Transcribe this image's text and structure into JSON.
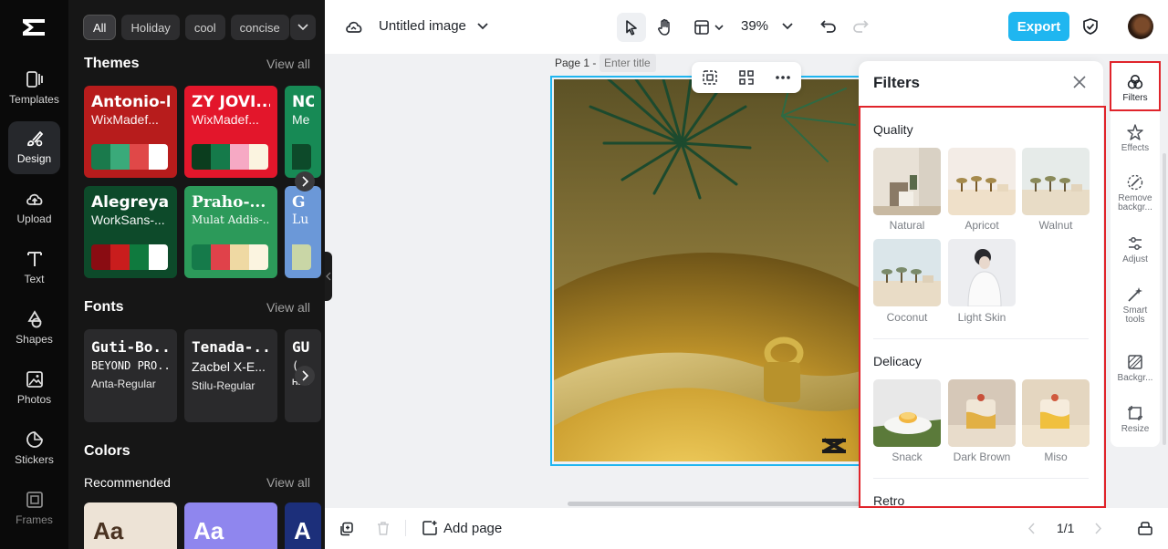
{
  "app": {
    "nav": [
      {
        "label": "Templates",
        "icon": "templates-icon"
      },
      {
        "label": "Design",
        "icon": "design-icon",
        "active": true
      },
      {
        "label": "Upload",
        "icon": "upload-cloud-icon"
      },
      {
        "label": "Text",
        "icon": "text-icon"
      },
      {
        "label": "Shapes",
        "icon": "shapes-icon"
      },
      {
        "label": "Photos",
        "icon": "photos-icon"
      },
      {
        "label": "Stickers",
        "icon": "stickers-icon"
      },
      {
        "label": "Frames",
        "icon": "frames-icon"
      }
    ]
  },
  "panel": {
    "chips": [
      "All",
      "Holiday",
      "cool",
      "concise"
    ],
    "themes": {
      "title": "Themes",
      "view_all": "View all",
      "cards": [
        {
          "font": "Antonio-Bold",
          "sub": "WixMadef...",
          "bg": "#b71c1c",
          "colors": [
            "#1a7a4c",
            "#3aaa7a",
            "#e04848",
            "#ffffff"
          ]
        },
        {
          "font": "ZY JOVI...",
          "sub": "WixMadef...",
          "bg": "#e3162b",
          "colors": [
            "#0b3d1e",
            "#157a4a",
            "#f6a9c4",
            "#fbf4e0"
          ]
        },
        {
          "font": "NO",
          "sub": "Me",
          "bg": "#178a55",
          "colors": [
            "#0d4a2a"
          ]
        },
        {
          "font": "AlegreyaS...",
          "sub": "WorkSans-...",
          "bg": "#0d4a2a",
          "colors": [
            "#8a0c12",
            "#c91d1d",
            "#0f7a3e",
            "#ffffff"
          ]
        },
        {
          "font": "Praho-...",
          "sub": "Mulat Addis-...",
          "bg": "#2c9a5a",
          "colors": [
            "#157a4a",
            "#e0424a",
            "#efd9a3",
            "#fbf4e0"
          ]
        },
        {
          "font": "G",
          "sub": "Lu",
          "bg": "#6b98d8",
          "colors": [
            "#c9d6a6"
          ]
        }
      ]
    },
    "fonts": {
      "title": "Fonts",
      "view_all": "View all",
      "cards": [
        {
          "f1": "Guti-Bo...",
          "f2": "BEYOND PRO...",
          "f3": "Anta-Regular"
        },
        {
          "f1": "Tenada-...",
          "f2": "Zacbel X-E...",
          "f3": "Stilu-Regular"
        },
        {
          "f1": "GU",
          "f2": "(",
          "f3": "Ham"
        }
      ]
    },
    "colors": {
      "title": "Colors",
      "subtitle": "Recommended",
      "view_all": "View all",
      "cards": [
        {
          "label": "Aa",
          "bg": "#ede3d6",
          "fg": "#4a3322"
        },
        {
          "label": "Aa",
          "bg": "#8f86ee",
          "fg": "#ffffff"
        },
        {
          "label": "A",
          "bg": "#1c2f7a",
          "fg": "#ffffff"
        }
      ]
    }
  },
  "topbar": {
    "title": "Untitled image",
    "zoom": "39%",
    "export": "Export"
  },
  "canvas": {
    "page_label": "Page 1 -",
    "title_placeholder": "Enter title"
  },
  "filters": {
    "title": "Filters",
    "sections": [
      {
        "name": "Quality",
        "items": [
          "Natural",
          "Apricot",
          "Walnut",
          "Coconut",
          "Light Skin"
        ]
      },
      {
        "name": "Delicacy",
        "items": [
          "Snack",
          "Dark Brown",
          "Miso"
        ]
      },
      {
        "name": "Retro",
        "items": []
      }
    ]
  },
  "right_rail": [
    {
      "label": "Filters",
      "icon": "filters-icon",
      "active": true
    },
    {
      "label": "Effects",
      "icon": "effects-icon"
    },
    {
      "label": "Remove backgr...",
      "icon": "remove-background-icon"
    },
    {
      "label": "Adjust",
      "icon": "adjust-icon"
    },
    {
      "label": "Smart tools",
      "icon": "smart-tools-icon"
    },
    {
      "label": "Backgr...",
      "icon": "background-icon"
    },
    {
      "label": "Resize",
      "icon": "resize-icon"
    }
  ],
  "bottombar": {
    "add_page": "Add page",
    "pager": "1/1"
  },
  "colors": {
    "accent": "#1fb6f0",
    "highlight": "#e0242b"
  }
}
